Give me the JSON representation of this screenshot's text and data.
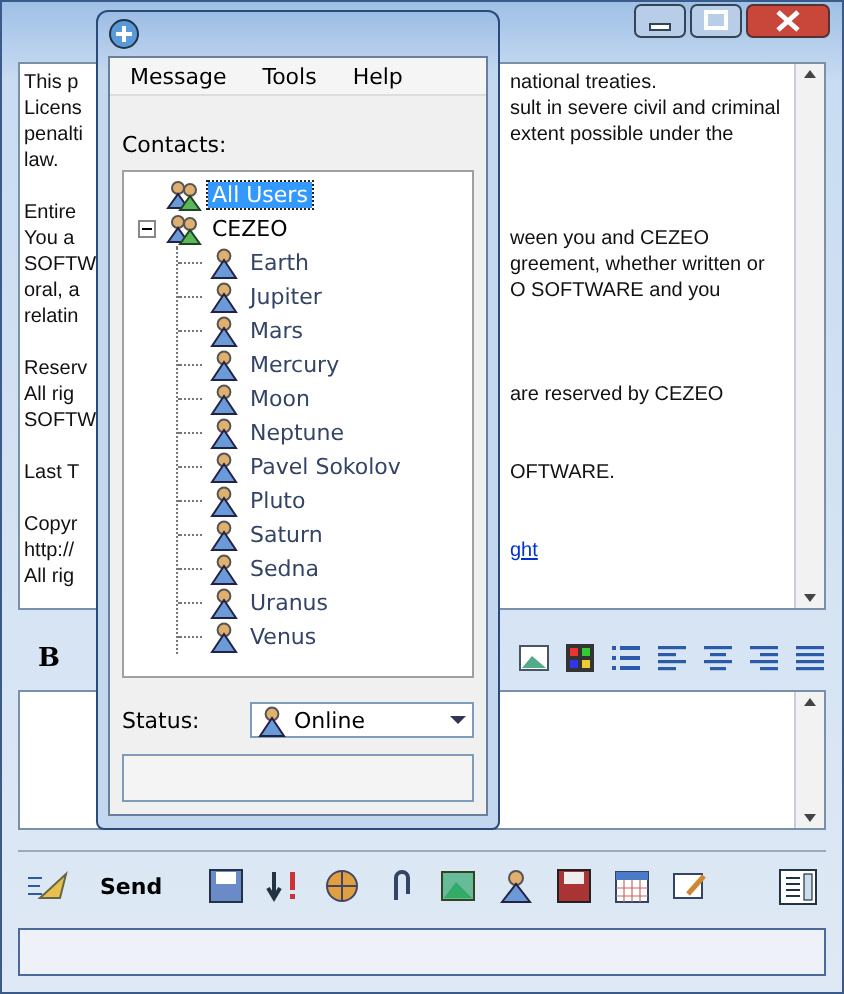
{
  "message_window": {
    "text_lines": [
      {
        "left": "This p",
        "right": "national treaties."
      },
      {
        "left": "Licens",
        "right": "sult in severe civil and criminal"
      },
      {
        "left": "penalti",
        "right": "extent possible under the"
      },
      {
        "left": "law."
      },
      {
        "kind": "blank"
      },
      {
        "left": "Entire"
      },
      {
        "left": "You a",
        "right": "ween you and CEZEO"
      },
      {
        "left": "SOFTW",
        "right": "greement, whether written or"
      },
      {
        "left": "oral, a",
        "right": "O SOFTWARE and you"
      },
      {
        "left": "relatin"
      },
      {
        "kind": "blank"
      },
      {
        "left": "Reserv"
      },
      {
        "left": "All rig",
        "right": "are reserved by CEZEO"
      },
      {
        "left": "SOFTW"
      },
      {
        "kind": "blank"
      },
      {
        "left": "Last T",
        "right": "OFTWARE."
      },
      {
        "kind": "blank"
      },
      {
        "left": "Copyr"
      },
      {
        "left": "http://",
        "right": "ght",
        "kind": "link"
      },
      {
        "left": "All rig"
      }
    ],
    "bold_button": "B",
    "send_button": "Send"
  },
  "contacts_window": {
    "menu": [
      "Message",
      "Tools",
      "Help"
    ],
    "contacts_label": "Contacts:",
    "tree": [
      {
        "label": "All Users",
        "kind": "group",
        "selected": true
      },
      {
        "label": "CEZEO",
        "kind": "group",
        "selected": false,
        "expanded": true,
        "children": [
          {
            "label": "Earth",
            "selected": false
          },
          {
            "label": "Jupiter",
            "selected": false
          },
          {
            "label": "Mars",
            "selected": false
          },
          {
            "label": "Mercury",
            "selected": false
          },
          {
            "label": "Moon",
            "selected": false
          },
          {
            "label": "Neptune",
            "selected": false
          },
          {
            "label": "Pavel Sokolov",
            "selected": false
          },
          {
            "label": "Pluto",
            "selected": false
          },
          {
            "label": "Saturn",
            "selected": false
          },
          {
            "label": "Sedna",
            "selected": false
          },
          {
            "label": "Uranus",
            "selected": false
          },
          {
            "label": "Venus",
            "selected": false
          }
        ]
      }
    ],
    "status_label": "Status:",
    "status_value": "Online"
  }
}
